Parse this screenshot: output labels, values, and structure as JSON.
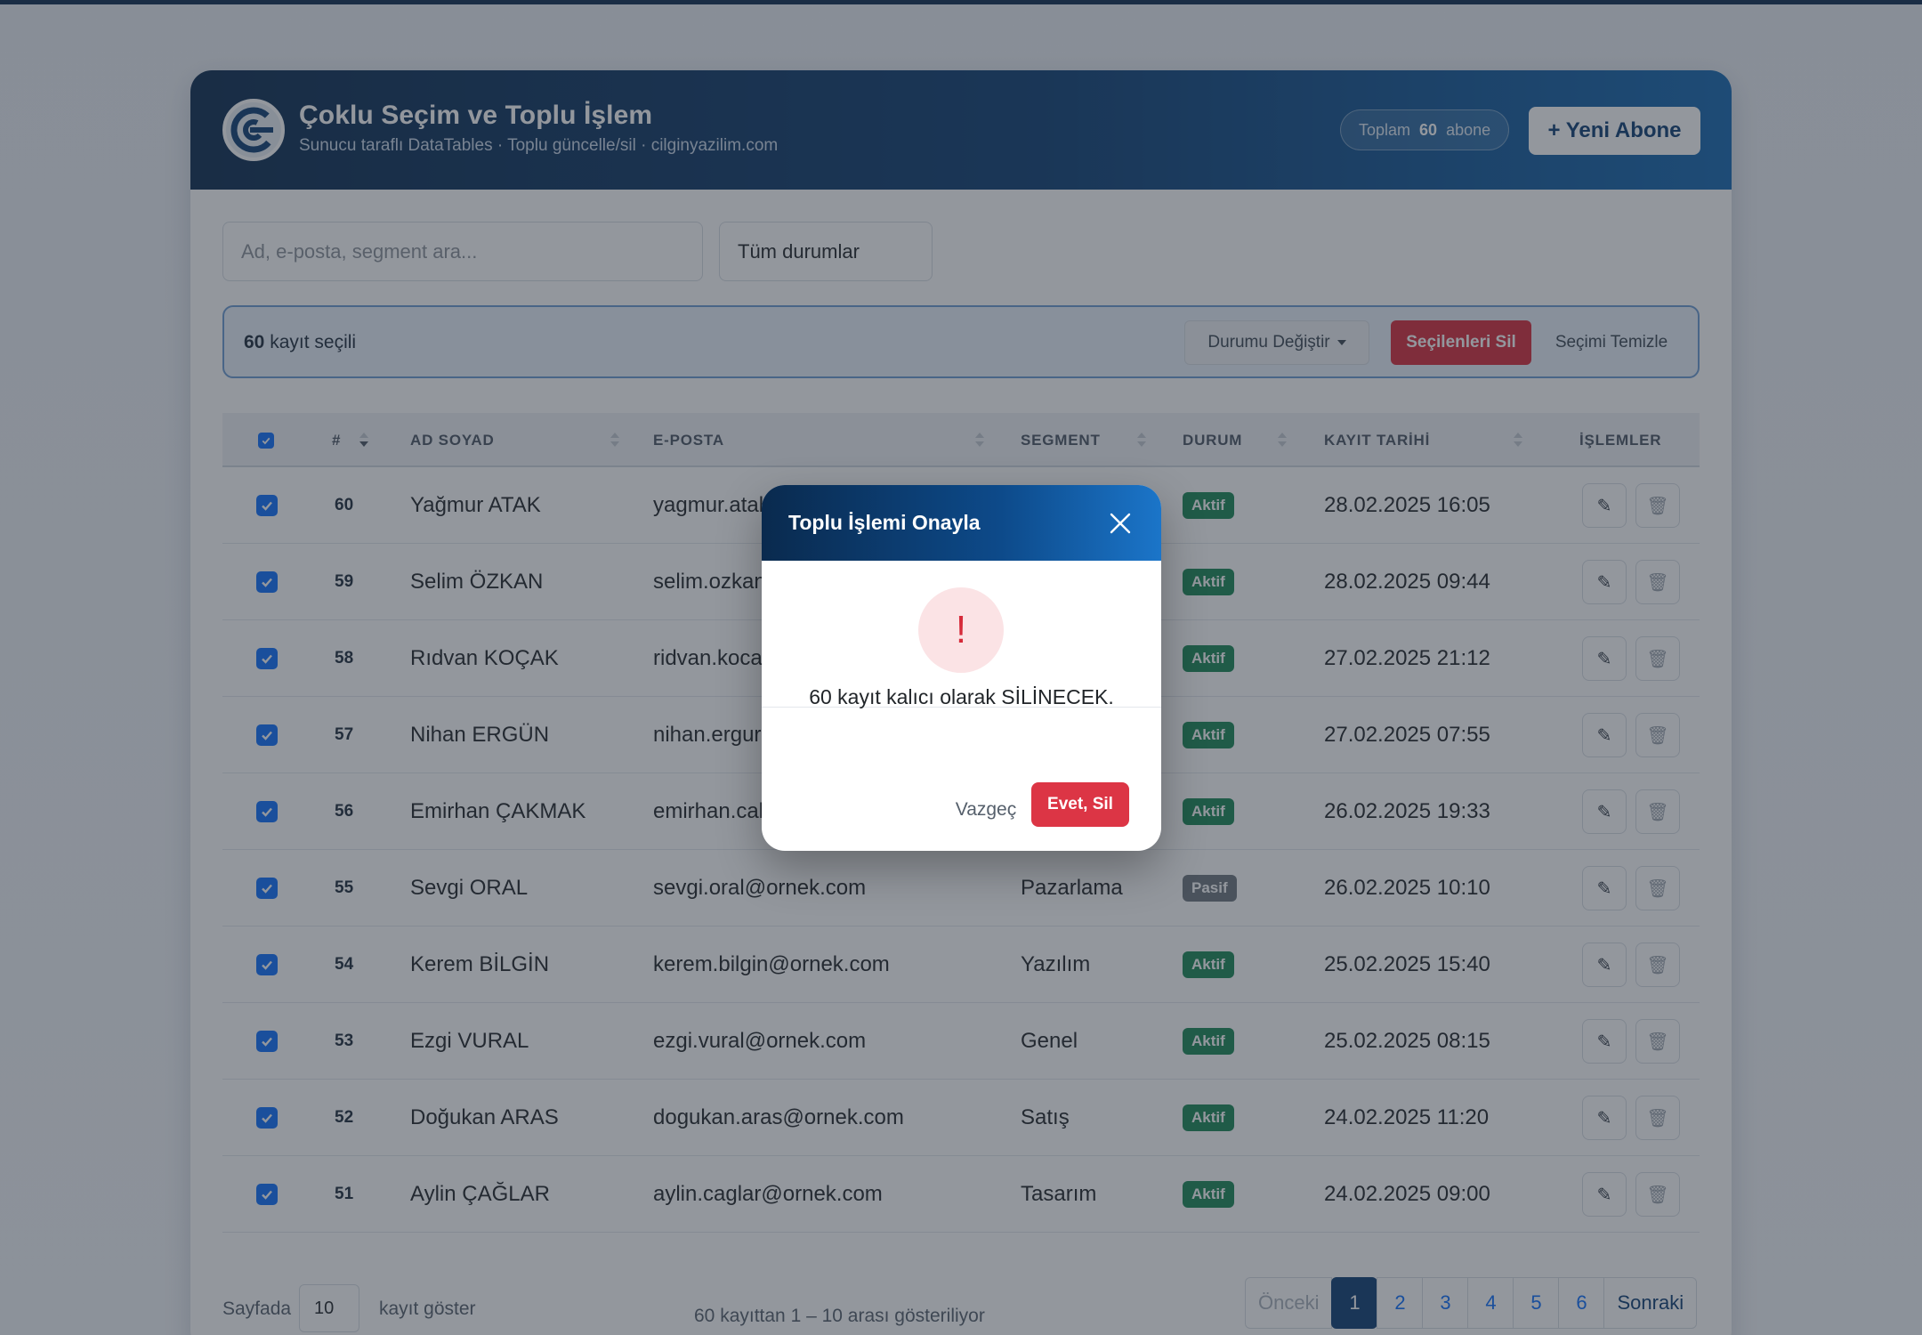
{
  "header": {
    "title": "Çoklu Seçim ve Toplu İşlem",
    "subtitle": "Sunucu taraflı DataTables · Toplu güncelle/sil · cilginyazilim.com",
    "total_prefix": "Toplam",
    "total_count": "60",
    "total_suffix": "abone",
    "new_button": "+ Yeni Abone"
  },
  "filters": {
    "search_placeholder": "Ad, e-posta, segment ara...",
    "status_select": "Tüm durumlar"
  },
  "bulk": {
    "count": "60",
    "count_label": "kayıt seçili",
    "change_status": "Durumu Değiştir",
    "delete_selected": "Seçilenleri Sil",
    "clear_selection": "Seçimi Temizle"
  },
  "table": {
    "headers": [
      "#",
      "AD SOYAD",
      "E-POSTA",
      "SEGMENT",
      "DURUM",
      "KAYIT TARİHİ",
      "İŞLEMLER"
    ],
    "rows": [
      {
        "id": "60",
        "name": "Yağmur ATAK",
        "email": "yagmur.atal",
        "segment": "",
        "status": "Aktif",
        "date": "28.02.2025 16:05"
      },
      {
        "id": "59",
        "name": "Selim ÖZKAN",
        "email": "selim.ozkan",
        "segment": "",
        "status": "Aktif",
        "date": "28.02.2025 09:44"
      },
      {
        "id": "58",
        "name": "Rıdvan KOÇAK",
        "email": "ridvan.koca",
        "segment": "",
        "status": "Aktif",
        "date": "27.02.2025 21:12"
      },
      {
        "id": "57",
        "name": "Nihan ERGÜN",
        "email": "nihan.ergur",
        "segment": "",
        "status": "Aktif",
        "date": "27.02.2025 07:55"
      },
      {
        "id": "56",
        "name": "Emirhan ÇAKMAK",
        "email": "emirhan.cal",
        "segment": "",
        "status": "Aktif",
        "date": "26.02.2025 19:33"
      },
      {
        "id": "55",
        "name": "Sevgi ORAL",
        "email": "sevgi.oral@ornek.com",
        "segment": "Pazarlama",
        "status": "Pasif",
        "date": "26.02.2025 10:10"
      },
      {
        "id": "54",
        "name": "Kerem BİLGİN",
        "email": "kerem.bilgin@ornek.com",
        "segment": "Yazılım",
        "status": "Aktif",
        "date": "25.02.2025 15:40"
      },
      {
        "id": "53",
        "name": "Ezgi VURAL",
        "email": "ezgi.vural@ornek.com",
        "segment": "Genel",
        "status": "Aktif",
        "date": "25.02.2025 08:15"
      },
      {
        "id": "52",
        "name": "Doğukan ARAS",
        "email": "dogukan.aras@ornek.com",
        "segment": "Satış",
        "status": "Aktif",
        "date": "24.02.2025 11:20"
      },
      {
        "id": "51",
        "name": "Aylin ÇAĞLAR",
        "email": "aylin.caglar@ornek.com",
        "segment": "Tasarım",
        "status": "Aktif",
        "date": "24.02.2025 09:00"
      }
    ]
  },
  "footer": {
    "length_prefix": "Sayfada",
    "length_value": "10",
    "length_suffix": "kayıt göster",
    "info": "60 kayıttan 1 – 10 arası gösteriliyor",
    "prev": "Önceki",
    "pages": [
      "1",
      "2",
      "3",
      "4",
      "5",
      "6"
    ],
    "next": "Sonraki"
  },
  "modal": {
    "title": "Toplu İşlemi Onayla",
    "icon": "!",
    "message": "60 kayıt kalıcı olarak SİLİNECEK.",
    "cancel": "Vazgeç",
    "confirm": "Evet, Sil"
  },
  "colors": {
    "header_dark": "#0a2a4e",
    "header_accent": "#1467b0",
    "danger": "#d62b3a",
    "success": "#198754",
    "primary": "#0d6efd"
  }
}
